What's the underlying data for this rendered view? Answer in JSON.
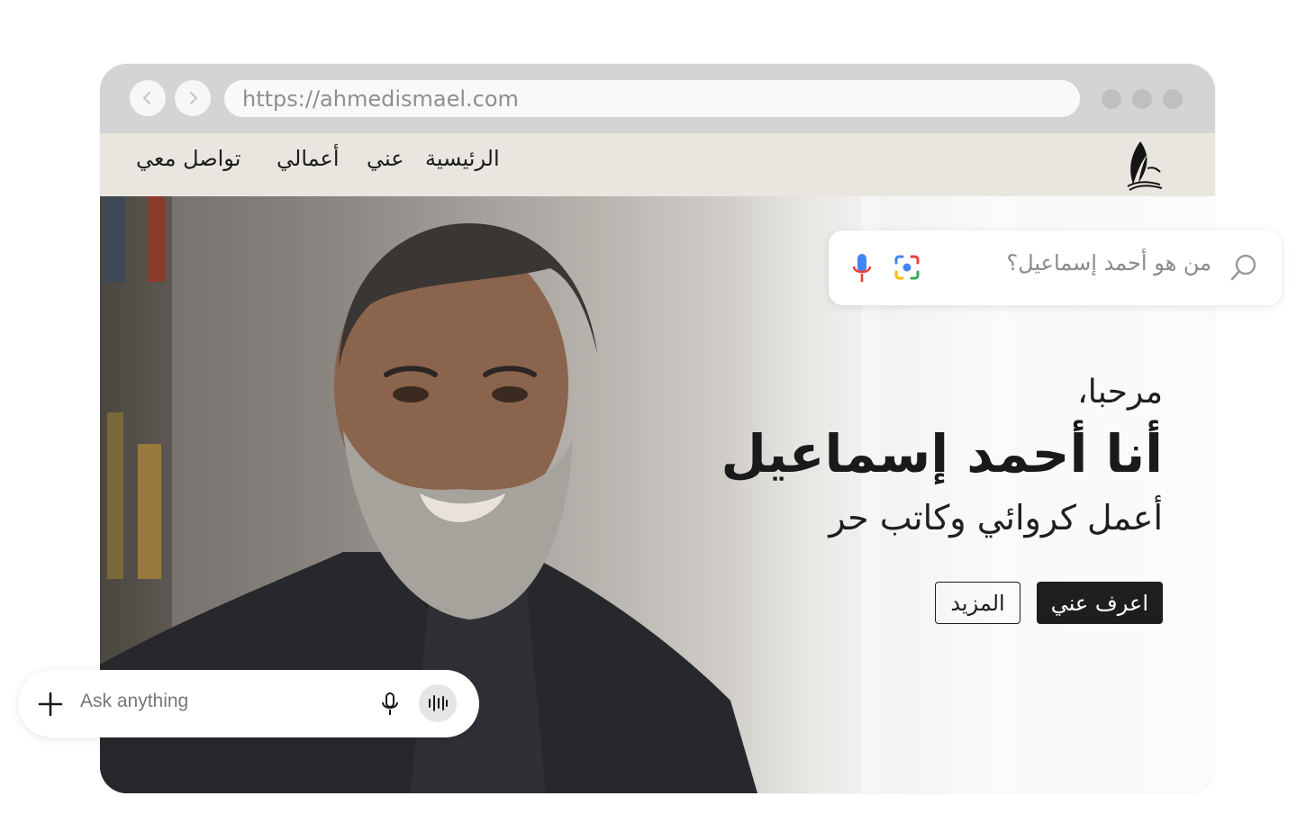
{
  "browser": {
    "url": "https://ahmedismael.com",
    "back_icon": "chevron-left-icon",
    "forward_icon": "chevron-right-icon"
  },
  "site_nav": {
    "logo_icon": "quill-book-icon",
    "items": [
      {
        "label": "الرئيسية"
      },
      {
        "label": "عني"
      },
      {
        "label": "أعمالي"
      },
      {
        "label": "تواصل معي"
      }
    ]
  },
  "hero": {
    "greeting": "مرحبا،",
    "name": "أنا أحمد إسماعيل",
    "role": "أعمل كروائي وكاتب حر",
    "primary_button": "اعرف عني",
    "secondary_button": "المزيد"
  },
  "search_widget": {
    "query_placeholder": "من هو أحمد إسماعيل؟",
    "search_icon": "search-icon",
    "lens_icon": "lens-icon",
    "mic_icon": "mic-icon"
  },
  "ask_widget": {
    "placeholder": "Ask anything",
    "add_icon": "plus-icon",
    "mic_icon": "mic-icon",
    "voice_icon": "voice-wave-icon"
  },
  "colors": {
    "nav_bg": "#e8e6df",
    "chrome_bg": "#d4d4d4",
    "primary_button_bg": "#1e1e1e"
  }
}
